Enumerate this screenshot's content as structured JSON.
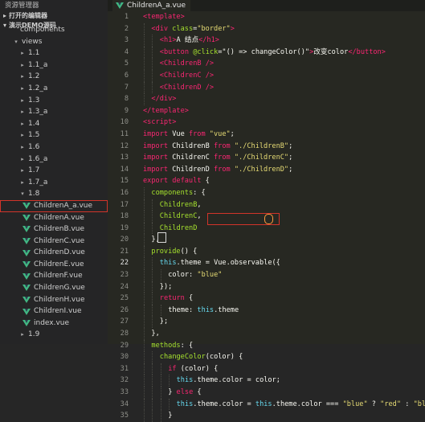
{
  "sidebar": {
    "title": "资源管理器",
    "sections": [
      "打开的编辑器",
      "演示DEMO源码"
    ],
    "items": [
      {
        "label": "components",
        "indent": 14,
        "arrow": "",
        "type": "folder"
      },
      {
        "label": "views",
        "indent": 16,
        "arrow": "▾",
        "type": "folder"
      },
      {
        "label": "1.1",
        "indent": 24,
        "arrow": "▸",
        "type": "folder"
      },
      {
        "label": "1.1_a",
        "indent": 24,
        "arrow": "▸",
        "type": "folder"
      },
      {
        "label": "1.2",
        "indent": 24,
        "arrow": "▸",
        "type": "folder"
      },
      {
        "label": "1.2_a",
        "indent": 24,
        "arrow": "▸",
        "type": "folder"
      },
      {
        "label": "1.3",
        "indent": 24,
        "arrow": "▸",
        "type": "folder"
      },
      {
        "label": "1.3_a",
        "indent": 24,
        "arrow": "▸",
        "type": "folder"
      },
      {
        "label": "1.4",
        "indent": 24,
        "arrow": "▸",
        "type": "folder"
      },
      {
        "label": "1.5",
        "indent": 24,
        "arrow": "▸",
        "type": "folder"
      },
      {
        "label": "1.6",
        "indent": 24,
        "arrow": "▸",
        "type": "folder"
      },
      {
        "label": "1.6_a",
        "indent": 24,
        "arrow": "▸",
        "type": "folder"
      },
      {
        "label": "1.7",
        "indent": 24,
        "arrow": "▸",
        "type": "folder"
      },
      {
        "label": "1.7_a",
        "indent": 24,
        "arrow": "▸",
        "type": "folder"
      },
      {
        "label": "1.8",
        "indent": 24,
        "arrow": "▾",
        "type": "folder"
      },
      {
        "label": "ChildrenA_a.vue",
        "indent": 28,
        "arrow": "",
        "type": "vue",
        "highlight": true
      },
      {
        "label": "ChildrenA.vue",
        "indent": 28,
        "arrow": "",
        "type": "vue"
      },
      {
        "label": "ChildrenB.vue",
        "indent": 28,
        "arrow": "",
        "type": "vue"
      },
      {
        "label": "ChildrenC.vue",
        "indent": 28,
        "arrow": "",
        "type": "vue"
      },
      {
        "label": "ChildrenD.vue",
        "indent": 28,
        "arrow": "",
        "type": "vue"
      },
      {
        "label": "ChildrenE.vue",
        "indent": 28,
        "arrow": "",
        "type": "vue"
      },
      {
        "label": "ChildrenF.vue",
        "indent": 28,
        "arrow": "",
        "type": "vue"
      },
      {
        "label": "ChildrenG.vue",
        "indent": 28,
        "arrow": "",
        "type": "vue"
      },
      {
        "label": "ChildrenH.vue",
        "indent": 28,
        "arrow": "",
        "type": "vue"
      },
      {
        "label": "ChildrenI.vue",
        "indent": 28,
        "arrow": "",
        "type": "vue"
      },
      {
        "label": "index.vue",
        "indent": 28,
        "arrow": "",
        "type": "vue"
      },
      {
        "label": "1.9",
        "indent": 24,
        "arrow": "▸",
        "type": "folder"
      }
    ]
  },
  "editor": {
    "tab_label": "ChildrenA_a.vue",
    "current_line": 22,
    "lines": [
      {
        "n": 1,
        "indent": 0,
        "tokens": [
          [
            "t-tag",
            "<template>"
          ]
        ]
      },
      {
        "n": 2,
        "indent": 1,
        "tokens": [
          [
            "t-tag",
            "<div "
          ],
          [
            "t-attr",
            "class"
          ],
          [
            "t-plain",
            "="
          ],
          [
            "t-str",
            "\"border\""
          ],
          [
            "t-tag",
            ">"
          ]
        ]
      },
      {
        "n": 3,
        "indent": 2,
        "tokens": [
          [
            "t-tag",
            "<h1>"
          ],
          [
            "t-plain",
            "A 结点"
          ],
          [
            "t-tag",
            "</h1>"
          ]
        ]
      },
      {
        "n": 4,
        "indent": 2,
        "tokens": [
          [
            "t-tag",
            "<button "
          ],
          [
            "t-attr",
            "@click"
          ],
          [
            "t-plain",
            "=\"() => changeColor()\""
          ],
          [
            "t-tag",
            ">"
          ],
          [
            "t-plain",
            "改变color"
          ],
          [
            "t-tag",
            "</button>"
          ]
        ]
      },
      {
        "n": 5,
        "indent": 2,
        "tokens": [
          [
            "t-tag",
            "<ChildrenB />"
          ]
        ]
      },
      {
        "n": 6,
        "indent": 2,
        "tokens": [
          [
            "t-tag",
            "<ChildrenC />"
          ]
        ]
      },
      {
        "n": 7,
        "indent": 2,
        "tokens": [
          [
            "t-tag",
            "<ChildrenD />"
          ]
        ]
      },
      {
        "n": 8,
        "indent": 1,
        "tokens": [
          [
            "t-tag",
            "</div>"
          ]
        ]
      },
      {
        "n": 9,
        "indent": 0,
        "tokens": [
          [
            "t-tag",
            "</template>"
          ]
        ]
      },
      {
        "n": 10,
        "indent": 0,
        "tokens": [
          [
            "t-tag",
            "<script>"
          ]
        ]
      },
      {
        "n": 11,
        "indent": 0,
        "tokens": [
          [
            "t-kw",
            "import "
          ],
          [
            "t-plain",
            "Vue "
          ],
          [
            "t-kw",
            "from "
          ],
          [
            "t-str",
            "\"vue\""
          ],
          [
            "t-plain",
            ";"
          ]
        ]
      },
      {
        "n": 12,
        "indent": 0,
        "tokens": [
          [
            "t-kw",
            "import "
          ],
          [
            "t-plain",
            "ChildrenB "
          ],
          [
            "t-kw",
            "from "
          ],
          [
            "t-str",
            "\"./ChildrenB\""
          ],
          [
            "t-plain",
            ";"
          ]
        ]
      },
      {
        "n": 13,
        "indent": 0,
        "tokens": [
          [
            "t-kw",
            "import "
          ],
          [
            "t-plain",
            "ChildrenC "
          ],
          [
            "t-kw",
            "from "
          ],
          [
            "t-str",
            "\"./ChildrenC\""
          ],
          [
            "t-plain",
            ";"
          ]
        ]
      },
      {
        "n": 14,
        "indent": 0,
        "tokens": [
          [
            "t-kw",
            "import "
          ],
          [
            "t-plain",
            "ChildrenD "
          ],
          [
            "t-kw",
            "from "
          ],
          [
            "t-str",
            "\"./ChildrenD\""
          ],
          [
            "t-plain",
            ";"
          ]
        ]
      },
      {
        "n": 15,
        "indent": 0,
        "tokens": [
          [
            "t-kw",
            "export default "
          ],
          [
            "t-plain",
            "{"
          ]
        ]
      },
      {
        "n": 16,
        "indent": 1,
        "tokens": [
          [
            "t-attr",
            "components"
          ],
          [
            "t-plain",
            ": {"
          ]
        ]
      },
      {
        "n": 17,
        "indent": 2,
        "tokens": [
          [
            "t-attr",
            "ChildrenB"
          ],
          [
            "t-plain",
            ","
          ]
        ]
      },
      {
        "n": 18,
        "indent": 2,
        "tokens": [
          [
            "t-attr",
            "ChildrenC"
          ],
          [
            "t-plain",
            ","
          ]
        ]
      },
      {
        "n": 19,
        "indent": 2,
        "tokens": [
          [
            "t-attr",
            "ChildrenD"
          ]
        ]
      },
      {
        "n": 20,
        "indent": 1,
        "tokens": [
          [
            "t-plain",
            "},"
          ]
        ]
      },
      {
        "n": 21,
        "indent": 1,
        "tokens": [
          [
            "t-attr",
            "provide"
          ],
          [
            "t-plain",
            "() {"
          ]
        ]
      },
      {
        "n": 22,
        "indent": 2,
        "tokens": [
          [
            "t-fn",
            "this"
          ],
          [
            "t-plain",
            ".theme = Vue.observable({"
          ]
        ]
      },
      {
        "n": 23,
        "indent": 3,
        "tokens": [
          [
            "t-plain",
            "color: "
          ],
          [
            "t-str",
            "\"blue\""
          ]
        ]
      },
      {
        "n": 24,
        "indent": 2,
        "tokens": [
          [
            "t-plain",
            "});"
          ]
        ]
      },
      {
        "n": 25,
        "indent": 2,
        "tokens": [
          [
            "t-kw",
            "return "
          ],
          [
            "t-plain",
            "{"
          ]
        ]
      },
      {
        "n": 26,
        "indent": 3,
        "tokens": [
          [
            "t-plain",
            "theme: "
          ],
          [
            "t-fn",
            "this"
          ],
          [
            "t-plain",
            ".theme"
          ]
        ]
      },
      {
        "n": 27,
        "indent": 2,
        "tokens": [
          [
            "t-plain",
            "};"
          ]
        ]
      },
      {
        "n": 28,
        "indent": 1,
        "tokens": [
          [
            "t-plain",
            "},"
          ]
        ]
      },
      {
        "n": 29,
        "indent": 1,
        "tokens": [
          [
            "t-attr",
            "methods"
          ],
          [
            "t-plain",
            ": {"
          ]
        ]
      },
      {
        "n": 30,
        "indent": 2,
        "tokens": [
          [
            "t-attr",
            "changeColor"
          ],
          [
            "t-plain",
            "(color) {"
          ]
        ]
      },
      {
        "n": 31,
        "indent": 3,
        "tokens": [
          [
            "t-kw",
            "if "
          ],
          [
            "t-plain",
            "(color) {"
          ]
        ]
      },
      {
        "n": 32,
        "indent": 4,
        "tokens": [
          [
            "t-fn",
            "this"
          ],
          [
            "t-plain",
            ".theme.color = color;"
          ]
        ]
      },
      {
        "n": 33,
        "indent": 3,
        "tokens": [
          [
            "t-plain",
            "} "
          ],
          [
            "t-kw",
            "else "
          ],
          [
            "t-plain",
            "{"
          ]
        ]
      },
      {
        "n": 34,
        "indent": 4,
        "tokens": [
          [
            "t-fn",
            "this"
          ],
          [
            "t-plain",
            ".theme.color = "
          ],
          [
            "t-fn",
            "this"
          ],
          [
            "t-plain",
            ".theme.color === "
          ],
          [
            "t-str",
            "\"blue\""
          ],
          [
            "t-plain",
            " ? "
          ],
          [
            "t-str",
            "\"red\""
          ],
          [
            "t-plain",
            " : "
          ],
          [
            "t-str",
            "\"blue\""
          ],
          [
            "t-plain",
            ";"
          ]
        ]
      },
      {
        "n": 35,
        "indent": 3,
        "tokens": [
          [
            "t-plain",
            "}"
          ]
        ]
      }
    ]
  }
}
